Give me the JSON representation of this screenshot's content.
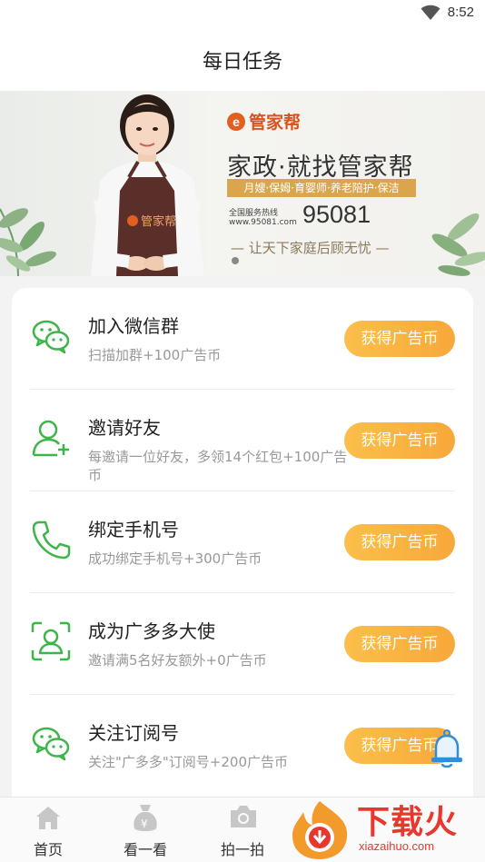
{
  "status_bar": {
    "time": "8:52",
    "wifi_icon": "wifi-icon"
  },
  "header": {
    "title": "每日任务"
  },
  "banner": {
    "logo_text": "管家帮",
    "logo_letter": "e",
    "apron_text": "管家帮",
    "headline": "家政·就找管家帮",
    "services": "月嫂·保姆·育婴师·养老陪护·保洁",
    "hotline_label": "全国服务热线",
    "hotline_url": "www.95081.com",
    "hotline_number": "95081",
    "slogan": "— 让天下家庭后顾无忧 —"
  },
  "tasks": [
    {
      "title": "加入微信群",
      "desc": "扫描加群+100广告币",
      "button": "获得广告币",
      "icon": "wechat-icon"
    },
    {
      "title": "邀请好友",
      "desc": "每邀请一位好友，多领14个红包+100广告币",
      "button": "获得广告币",
      "icon": "add-user-icon"
    },
    {
      "title": "绑定手机号",
      "desc": "成功绑定手机号+300广告币",
      "button": "获得广告币",
      "icon": "phone-icon"
    },
    {
      "title": "成为广多多大使",
      "desc": "邀请满5名好友额外+0广告币",
      "button": "获得广告币",
      "icon": "face-scan-icon"
    },
    {
      "title": "关注订阅号",
      "desc": "关注\"广多多\"订阅号+200广告币",
      "button": "获得广告币",
      "icon": "wechat-icon"
    }
  ],
  "tabbar": {
    "items": [
      {
        "label": "首页",
        "icon": "home-icon"
      },
      {
        "label": "看一看",
        "icon": "money-bag-icon"
      },
      {
        "label": "拍一拍",
        "icon": "camera-icon"
      }
    ]
  },
  "watermark": {
    "text": "下载火",
    "url": "xiazaihuo.com"
  },
  "colors": {
    "accent_green": "#3cb54a",
    "button_orange": "#f9b444",
    "watermark_red": "#e8372c"
  }
}
